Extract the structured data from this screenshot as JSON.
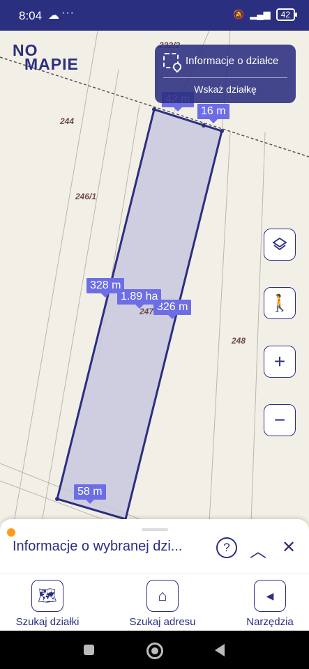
{
  "status": {
    "time": "8:04",
    "battery": "42"
  },
  "logo": {
    "line1": "NO",
    "line2": "MAPIE"
  },
  "info_panel": {
    "title": "Informacje o działce",
    "action": "Wskaż działkę"
  },
  "measurements": {
    "top_left": "42 m",
    "top_right": "16 m",
    "left": "328 m",
    "right": "326 m",
    "area": "1.89 ha",
    "bottom": "58 m"
  },
  "plot_labels": {
    "p244": "244",
    "p246_1": "246/1",
    "p247": "247",
    "p248": "248",
    "p232": "232/2"
  },
  "sheet": {
    "title": "Informacje o wybranej dzi..."
  },
  "nav": [
    {
      "label": "Szukaj działki",
      "icon": "map-search-icon"
    },
    {
      "label": "Szukaj adresu",
      "icon": "home-search-icon"
    },
    {
      "label": "Narzędzia",
      "icon": "chevron-left-icon"
    }
  ],
  "colors": {
    "brand": "#2b2f80",
    "measure": "#6d6ee6",
    "parcel_fill": "#c9c8df",
    "accent_dot": "#ff9b1a"
  }
}
